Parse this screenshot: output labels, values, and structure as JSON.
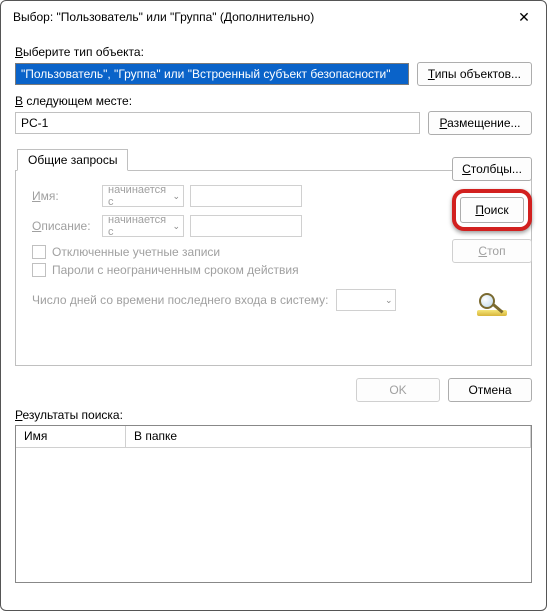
{
  "title": "Выбор: \"Пользователь\" или \"Группа\" (Дополнительно)",
  "close_glyph": "✕",
  "object_type": {
    "label_pre": "В",
    "label_rest": "ыберите тип объекта:",
    "value": "\"Пользователь\", \"Группа\" или \"Встроенный субъект безопасности\"",
    "button_pre": "Т",
    "button_rest": "ипы объектов..."
  },
  "location": {
    "label_pre": "В",
    "label_rest": " следующем месте:",
    "value": "PC-1",
    "button_pre": "Р",
    "button_rest": "азмещение..."
  },
  "tab": {
    "label": "Общие запросы",
    "name": {
      "pre": "И",
      "rest": "мя:"
    },
    "desc": {
      "pre": "О",
      "rest": "писание:"
    },
    "combo_value": "начинается с",
    "chk1": "Отключенные учетные записи",
    "chk2": "Пароли с неограниченным сроком действия",
    "days_label": "Число дней со времени последнего входа в систему:"
  },
  "side": {
    "columns_pre": "С",
    "columns_rest": "толбцы...",
    "search_pre": "П",
    "search_rest": "оиск",
    "stop_pre": "С",
    "stop_rest": "топ"
  },
  "actions": {
    "ok": "OK",
    "cancel": "Отмена"
  },
  "results": {
    "label_pre": "Р",
    "label_rest": "езультаты поиска:",
    "col_name": "Имя",
    "col_folder": "В папке"
  }
}
